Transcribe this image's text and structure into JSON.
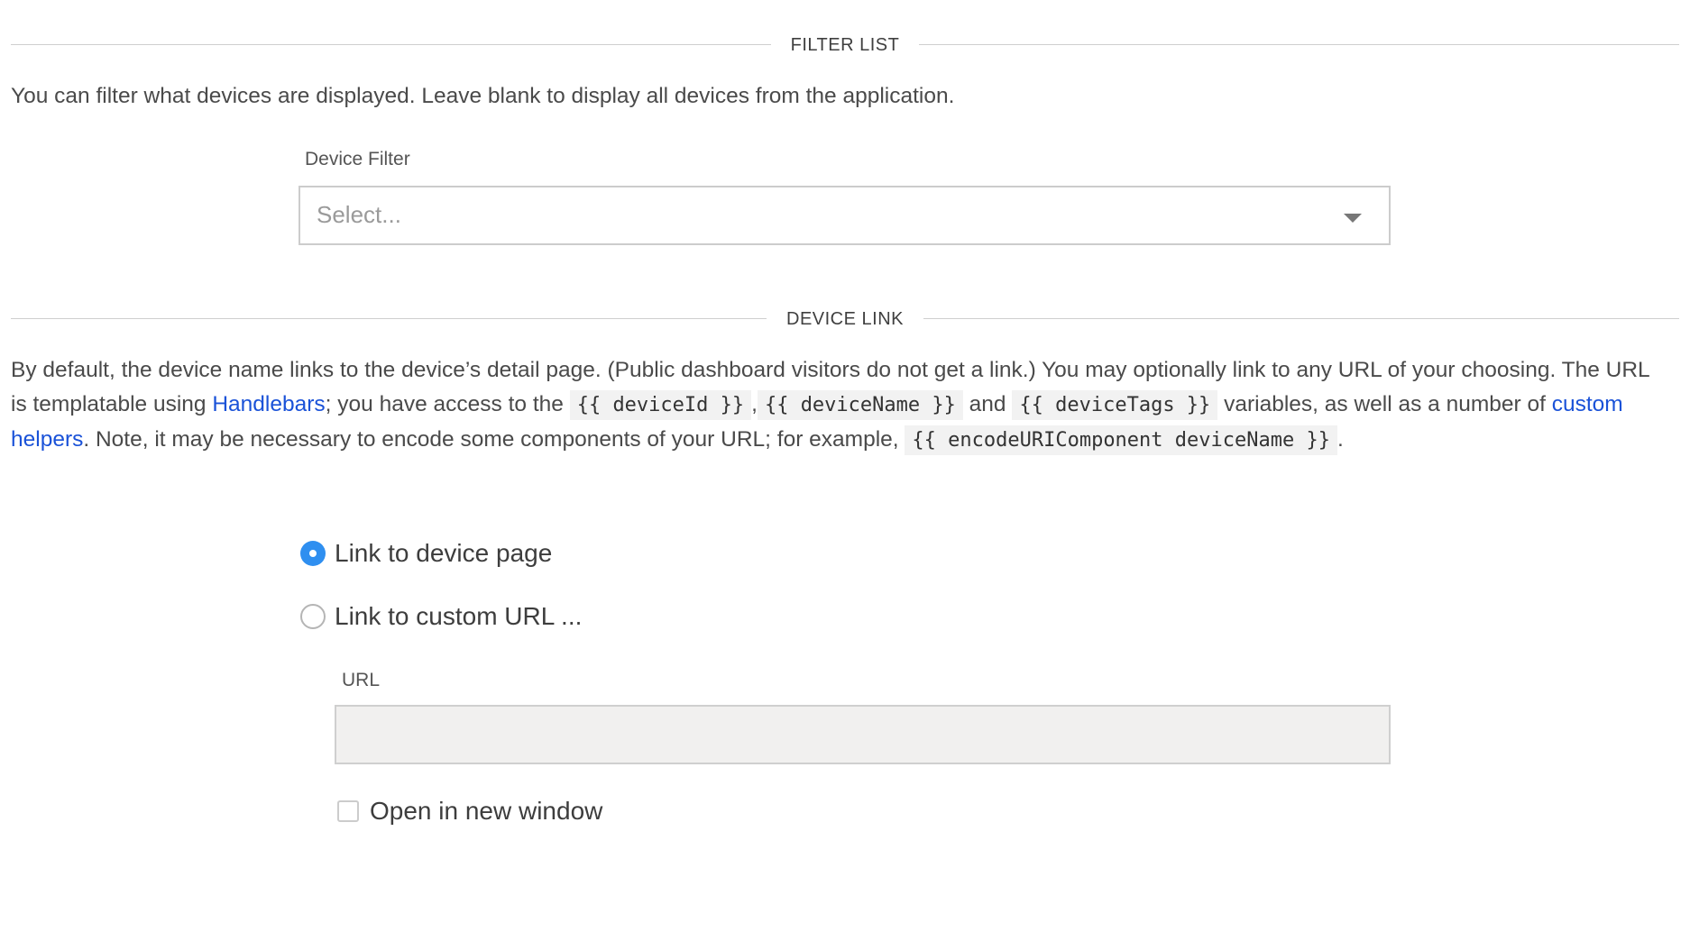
{
  "filter_section": {
    "title": "FILTER LIST",
    "description": "You can filter what devices are displayed. Leave blank to display all devices from the application.",
    "device_filter_label": "Device Filter",
    "device_filter_placeholder": "Select..."
  },
  "link_section": {
    "title": "DEVICE LINK",
    "desc_part1": "By default, the device name links to the device’s detail page. (Public dashboard visitors do not get a link.) You may optionally link to any URL of your choosing. The URL is templatable using ",
    "handlebars_link": "Handlebars",
    "desc_part2": "; you have access to the ",
    "code_device_id": "{{ deviceId }}",
    "comma": ",",
    "code_device_name": "{{ deviceName }}",
    "and_text": " and ",
    "code_device_tags": "{{ deviceTags }}",
    "desc_part3": " variables, as well as a number of ",
    "custom_helpers_link": "custom helpers",
    "desc_part4": ". Note, it may be necessary to encode some components of your URL; for example, ",
    "code_encode": "{{ encodeURIComponent deviceName }}",
    "period": ".",
    "radio_device_page": "Link to device page",
    "radio_custom_url": "Link to custom URL ...",
    "url_label": "URL",
    "url_value": "",
    "open_new_window_label": "Open in new window",
    "selected_option": "device_page",
    "accent_color": "#2f8ff0",
    "link_color": "#1a52d8"
  }
}
